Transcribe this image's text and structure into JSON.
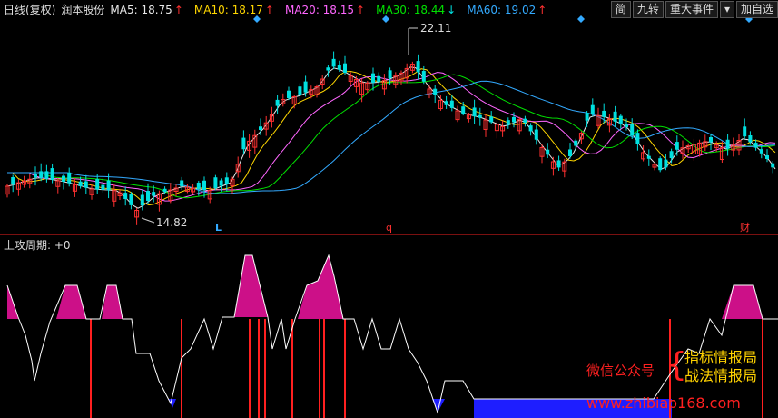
{
  "legend": {
    "period": "日线(复权)",
    "stock": "润本股份",
    "ma": [
      {
        "label": "MA5: 18.75",
        "dir": "up",
        "color": "#e8e8e8"
      },
      {
        "label": "MA10: 18.17",
        "dir": "up",
        "color": "#ffd700"
      },
      {
        "label": "MA20: 18.15",
        "dir": "up",
        "color": "#ff66ff"
      },
      {
        "label": "MA30: 18.44",
        "dir": "down",
        "color": "#00e000"
      },
      {
        "label": "MA60: 19.02",
        "dir": "up",
        "color": "#33aaff"
      }
    ]
  },
  "toolbar": {
    "jian": "简",
    "jiuzhuan": "九转",
    "events": "重大事件",
    "add": "加自选"
  },
  "price_marks": {
    "high": "22.11",
    "low": "14.82",
    "L": "L",
    "q": "q",
    "cai": "财"
  },
  "oscillator": {
    "title": "上攻周期: +0"
  },
  "watermark": {
    "wechat": "微信公众号",
    "line1": "指标情报局",
    "line2": "战法情报局",
    "url": "www.zhibiao168.com"
  },
  "colors": {
    "up": "#ff3030",
    "down": "#00e0e0",
    "magenta": "#cc1088",
    "blue": "#1e1eff"
  }
}
